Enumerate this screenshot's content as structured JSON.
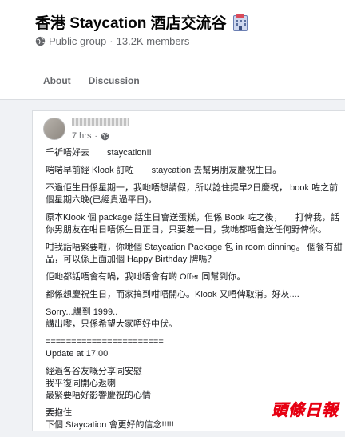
{
  "group": {
    "title": "香港 Staycation 酒店交流谷",
    "title_icon": "hotel-icon",
    "privacy": "Public group",
    "separator": "·",
    "members": "13.2K members"
  },
  "tabs": [
    {
      "label": "About"
    },
    {
      "label": "Discussion"
    }
  ],
  "post": {
    "time": "7 hrs",
    "dot": "·",
    "paragraphs": [
      "千祈唔好去　　staycation!!",
      "啱啱早前經 Klook 訂咗　　staycation 去幫男朋友慶祝生日。",
      "不過佢生日係星期一，我哋唔想請假，所以諗住提早2日慶祝， book 咗之前個星期六晚(已經貴過平日)。",
      "原本Klook 個 package 話生日會送蛋糕，但係 Book 咗之後，　　打俾我，話你男朋友在咁日唔係生日正日，只要差一日，我哋都唔會送任何野俾你。",
      "咁我話唔緊要啦，你哋個 Staycation Package 包 in room dinning。 個餐有甜品，可以係上面加個 Happy Birthday 牌嗎？",
      "佢哋都話唔會有喎，我哋唔會有啲 Offer 同幫到你。",
      "都係想慶祝生日，而家搞到咁唔開心。Klook 又唔俾取消。好灰....",
      "Sorry...講到 1999..\n講出嚟，只係希望大家唔好中伏。",
      "=======================\nUpdate at 17:00",
      "經過各谷友嘅分享同安慰\n我平復同開心返喇\n最緊要唔好影響慶祝的心情",
      "要抱住\n下個 Staycation 會更好的信念!!!!!"
    ]
  },
  "watermark": "頭條日報",
  "colors": {
    "background": "#f0f2f5",
    "card": "#ffffff",
    "secondary_text": "#65676b",
    "watermark_red": "#e60012"
  }
}
